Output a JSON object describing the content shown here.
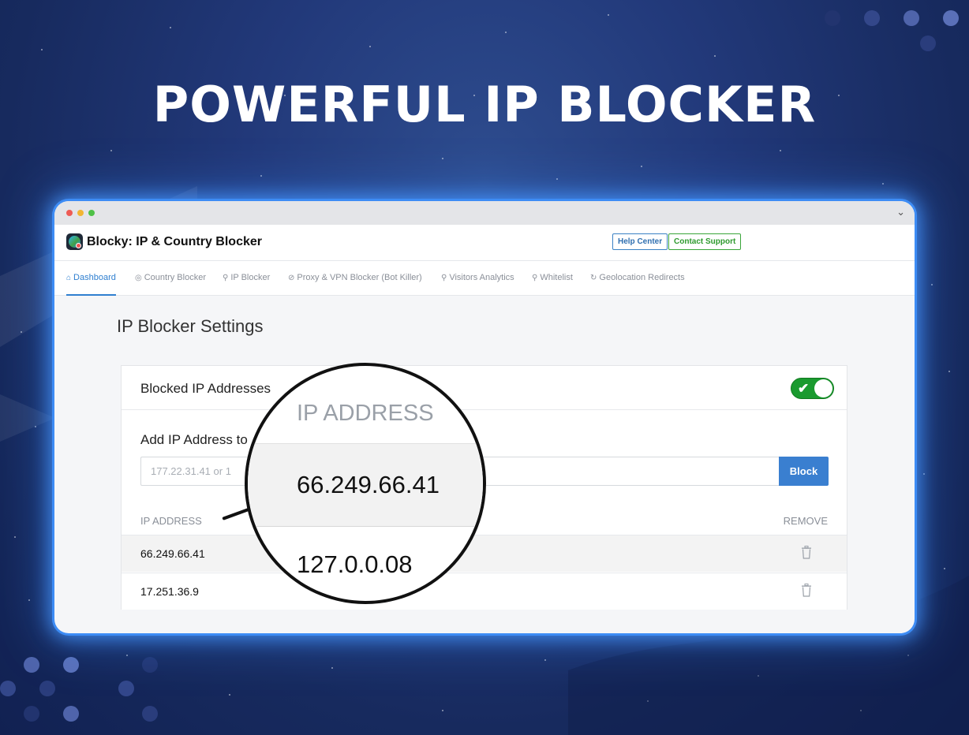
{
  "hero": {
    "title": "POWERFUL IP BLOCKER"
  },
  "app": {
    "title": "Blocky: IP & Country Blocker",
    "help_label": "Help Center",
    "support_label": "Contact Support"
  },
  "nav": {
    "tabs": [
      {
        "label": "Dashboard",
        "icon": "home-icon",
        "active": true
      },
      {
        "label": "Country Blocker",
        "icon": "globe-icon"
      },
      {
        "label": "IP Blocker",
        "icon": "user-plus-icon"
      },
      {
        "label": "Proxy & VPN Blocker (Bot Killer)",
        "icon": "shield-off-icon"
      },
      {
        "label": "Visitors Analytics",
        "icon": "search-icon"
      },
      {
        "label": "Whitelist",
        "icon": "user-check-icon"
      },
      {
        "label": "Geolocation Redirects",
        "icon": "refresh-icon"
      }
    ]
  },
  "settings": {
    "title": "IP Blocker Settings",
    "card_title": "Blocked IP Addresses",
    "toggle_on": true,
    "add_label": "Add IP Address to",
    "input_placeholder": "177.22.31.41 or 1",
    "block_label": "Block",
    "col_ip": "IP ADDRESS",
    "col_remove": "REMOVE",
    "rows": [
      {
        "ip": "66.249.66.41"
      },
      {
        "ip": "17.251.36.9"
      }
    ]
  },
  "magnifier": {
    "header": "IP ADDRESS",
    "ip1": "66.249.66.41",
    "ip2": "127.0.0.08"
  },
  "colors": {
    "accent": "#2f7fd0",
    "toggle": "#1a9a2f",
    "background": "#1d3170"
  }
}
